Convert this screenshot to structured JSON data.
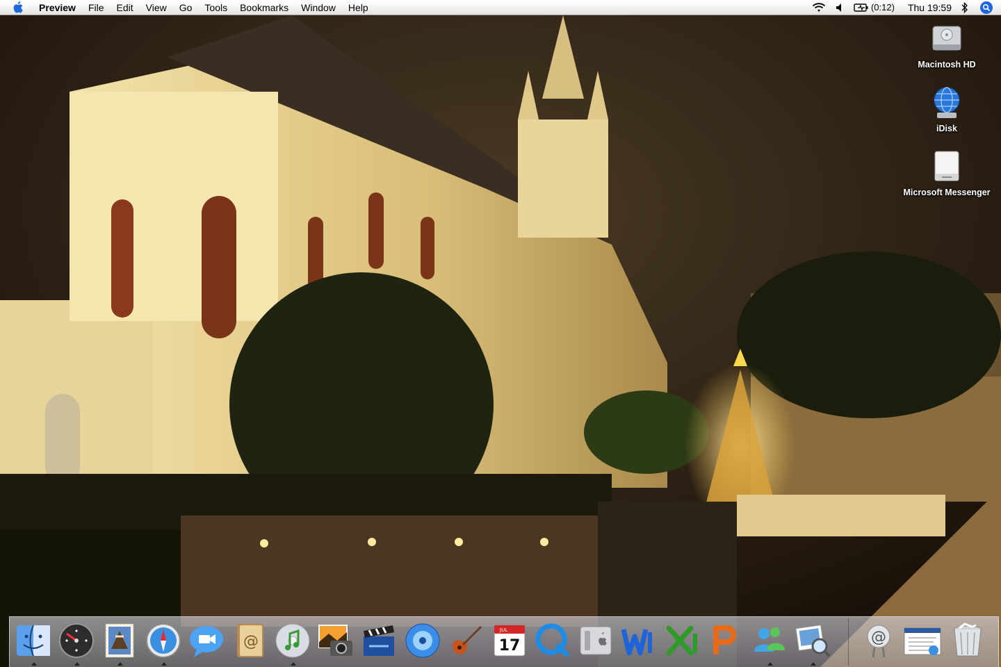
{
  "menubar": {
    "app_name": "Preview",
    "items": [
      "File",
      "Edit",
      "View",
      "Go",
      "Tools",
      "Bookmarks",
      "Window",
      "Help"
    ],
    "battery_text": "(0:12)",
    "clock": "Thu 19:59",
    "status_icons": [
      "wifi-icon",
      "volume-icon",
      "battery-icon",
      "bluetooth-icon",
      "spotlight-icon"
    ]
  },
  "desktop": {
    "icons": [
      {
        "label": "Macintosh HD",
        "icon": "hard-drive-icon"
      },
      {
        "label": "iDisk",
        "icon": "idisk-globe-icon"
      },
      {
        "label": "Microsoft Messenger",
        "icon": "drive-volume-icon"
      }
    ],
    "wallpaper": "Chapel lit at night with Christmas tree"
  },
  "dock": {
    "apps": [
      {
        "name": "Finder",
        "icon": "finder-icon",
        "running": true
      },
      {
        "name": "Dashboard",
        "icon": "dashboard-icon",
        "running": true
      },
      {
        "name": "Mail",
        "icon": "mail-stamp-icon",
        "running": true
      },
      {
        "name": "Safari",
        "icon": "safari-compass-icon",
        "running": true
      },
      {
        "name": "iChat",
        "icon": "ichat-icon",
        "running": false
      },
      {
        "name": "Address Book",
        "icon": "address-book-icon",
        "running": false
      },
      {
        "name": "iTunes",
        "icon": "itunes-icon",
        "running": true
      },
      {
        "name": "iPhoto",
        "icon": "iphoto-icon",
        "running": false
      },
      {
        "name": "iMovie",
        "icon": "imovie-clapper-icon",
        "running": false
      },
      {
        "name": "iDVD",
        "icon": "idvd-icon",
        "running": false
      },
      {
        "name": "GarageBand",
        "icon": "garageband-guitar-icon",
        "running": false
      },
      {
        "name": "iCal",
        "icon": "ical-calendar-icon",
        "running": false,
        "month": "JUL",
        "day": "17"
      },
      {
        "name": "QuickTime Player",
        "icon": "quicktime-icon",
        "running": false
      },
      {
        "name": "System Preferences",
        "icon": "system-preferences-icon",
        "running": false
      },
      {
        "name": "Microsoft Word",
        "icon": "word-icon",
        "running": false
      },
      {
        "name": "Microsoft Excel",
        "icon": "excel-icon",
        "running": false
      },
      {
        "name": "Microsoft PowerPoint",
        "icon": "powerpoint-icon",
        "running": false
      },
      {
        "name": "Microsoft Messenger",
        "icon": "messenger-icon",
        "running": true
      },
      {
        "name": "Preview",
        "icon": "preview-icon",
        "running": true
      }
    ],
    "right_items": [
      {
        "name": "Mail Docklet",
        "icon": "at-sign-icon"
      },
      {
        "name": "Document",
        "icon": "document-icon"
      },
      {
        "name": "Trash",
        "icon": "trash-icon"
      }
    ]
  },
  "colors": {
    "accent": "#1e63e0",
    "menubar": "#f1f1f1",
    "dock": "#c8c8d4"
  }
}
